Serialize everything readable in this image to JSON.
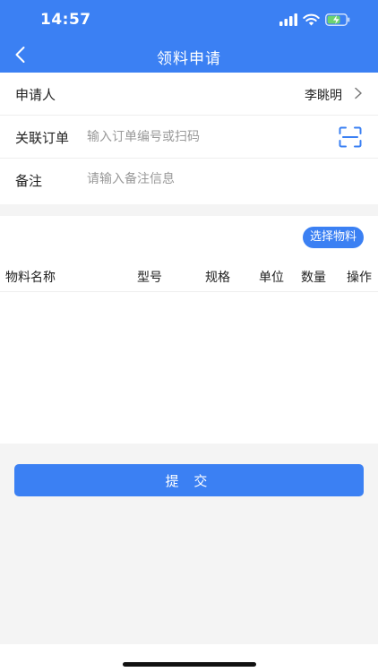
{
  "status_bar": {
    "time": "14:57"
  },
  "nav": {
    "title": "领料申请"
  },
  "form": {
    "applicant": {
      "label": "申请人",
      "value": "李眺明"
    },
    "order": {
      "label": "关联订单",
      "placeholder": "输入订单编号或扫码",
      "value": ""
    },
    "remark": {
      "label": "备注",
      "placeholder": "请输入备注信息",
      "value": ""
    }
  },
  "materials": {
    "select_button": "选择物料",
    "columns": [
      "物料名称",
      "型号",
      "规格",
      "单位",
      "数量",
      "操作"
    ],
    "rows": []
  },
  "submit_label": "提 交",
  "colors": {
    "primary": "#3b80f3",
    "background": "#f4f4f4"
  }
}
